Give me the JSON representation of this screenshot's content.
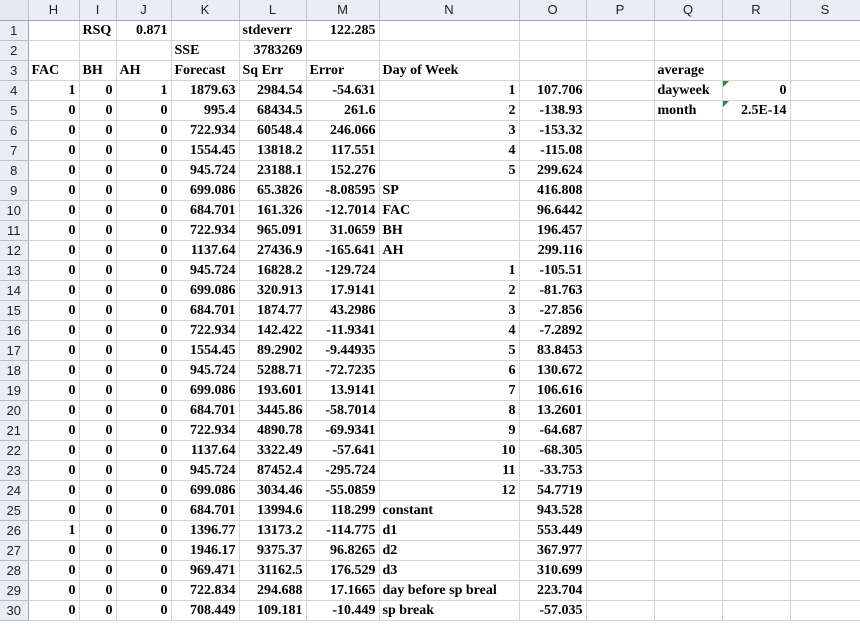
{
  "columns": [
    "H",
    "I",
    "J",
    "K",
    "L",
    "M",
    "N",
    "O",
    "P",
    "Q",
    "R",
    "S"
  ],
  "rows": [
    {
      "n": "1",
      "cells": {
        "I": "RSQ",
        "J": "0.871",
        "L": "stdeverr",
        "M": "122.285"
      }
    },
    {
      "n": "2",
      "cells": {
        "K": "SSE",
        "L": "3783269"
      }
    },
    {
      "n": "3",
      "cells": {
        "H": "FAC",
        "I": "BH",
        "J": "AH",
        "K": "Forecast",
        "L": "Sq Err",
        "M": "Error",
        "N": "Day of Week",
        "Q": "average"
      }
    },
    {
      "n": "4",
      "cells": {
        "H": "1",
        "I": "0",
        "J": "1",
        "K": "1879.63",
        "L": "2984.54",
        "M": "-54.631",
        "N": "1",
        "O": "107.706",
        "Q": "dayweek",
        "R": "0"
      }
    },
    {
      "n": "5",
      "cells": {
        "H": "0",
        "I": "0",
        "J": "0",
        "K": "995.4",
        "L": "68434.5",
        "M": "261.6",
        "N": "2",
        "O": "-138.93",
        "Q": "month",
        "R": "2.5E-14"
      }
    },
    {
      "n": "6",
      "cells": {
        "H": "0",
        "I": "0",
        "J": "0",
        "K": "722.934",
        "L": "60548.4",
        "M": "246.066",
        "N": "3",
        "O": "-153.32"
      }
    },
    {
      "n": "7",
      "cells": {
        "H": "0",
        "I": "0",
        "J": "0",
        "K": "1554.45",
        "L": "13818.2",
        "M": "117.551",
        "N": "4",
        "O": "-115.08"
      }
    },
    {
      "n": "8",
      "cells": {
        "H": "0",
        "I": "0",
        "J": "0",
        "K": "945.724",
        "L": "23188.1",
        "M": "152.276",
        "N": "5",
        "O": "299.624"
      }
    },
    {
      "n": "9",
      "cells": {
        "H": "0",
        "I": "0",
        "J": "0",
        "K": "699.086",
        "L": "65.3826",
        "M": "-8.08595",
        "N": "SP",
        "O": "416.808"
      }
    },
    {
      "n": "10",
      "cells": {
        "H": "0",
        "I": "0",
        "J": "0",
        "K": "684.701",
        "L": "161.326",
        "M": "-12.7014",
        "N": "FAC",
        "O": "96.6442"
      }
    },
    {
      "n": "11",
      "cells": {
        "H": "0",
        "I": "0",
        "J": "0",
        "K": "722.934",
        "L": "965.091",
        "M": "31.0659",
        "N": "BH",
        "O": "196.457"
      }
    },
    {
      "n": "12",
      "cells": {
        "H": "0",
        "I": "0",
        "J": "0",
        "K": "1137.64",
        "L": "27436.9",
        "M": "-165.641",
        "N": "AH",
        "O": "299.116"
      }
    },
    {
      "n": "13",
      "cells": {
        "H": "0",
        "I": "0",
        "J": "0",
        "K": "945.724",
        "L": "16828.2",
        "M": "-129.724",
        "N": "1",
        "O": "-105.51"
      }
    },
    {
      "n": "14",
      "cells": {
        "H": "0",
        "I": "0",
        "J": "0",
        "K": "699.086",
        "L": "320.913",
        "M": "17.9141",
        "N": "2",
        "O": "-81.763"
      }
    },
    {
      "n": "15",
      "cells": {
        "H": "0",
        "I": "0",
        "J": "0",
        "K": "684.701",
        "L": "1874.77",
        "M": "43.2986",
        "N": "3",
        "O": "-27.856"
      }
    },
    {
      "n": "16",
      "cells": {
        "H": "0",
        "I": "0",
        "J": "0",
        "K": "722.934",
        "L": "142.422",
        "M": "-11.9341",
        "N": "4",
        "O": "-7.2892"
      }
    },
    {
      "n": "17",
      "cells": {
        "H": "0",
        "I": "0",
        "J": "0",
        "K": "1554.45",
        "L": "89.2902",
        "M": "-9.44935",
        "N": "5",
        "O": "83.8453"
      }
    },
    {
      "n": "18",
      "cells": {
        "H": "0",
        "I": "0",
        "J": "0",
        "K": "945.724",
        "L": "5288.71",
        "M": "-72.7235",
        "N": "6",
        "O": "130.672"
      }
    },
    {
      "n": "19",
      "cells": {
        "H": "0",
        "I": "0",
        "J": "0",
        "K": "699.086",
        "L": "193.601",
        "M": "13.9141",
        "N": "7",
        "O": "106.616"
      }
    },
    {
      "n": "20",
      "cells": {
        "H": "0",
        "I": "0",
        "J": "0",
        "K": "684.701",
        "L": "3445.86",
        "M": "-58.7014",
        "N": "8",
        "O": "13.2601"
      }
    },
    {
      "n": "21",
      "cells": {
        "H": "0",
        "I": "0",
        "J": "0",
        "K": "722.934",
        "L": "4890.78",
        "M": "-69.9341",
        "N": "9",
        "O": "-64.687"
      }
    },
    {
      "n": "22",
      "cells": {
        "H": "0",
        "I": "0",
        "J": "0",
        "K": "1137.64",
        "L": "3322.49",
        "M": "-57.641",
        "N": "10",
        "O": "-68.305"
      }
    },
    {
      "n": "23",
      "cells": {
        "H": "0",
        "I": "0",
        "J": "0",
        "K": "945.724",
        "L": "87452.4",
        "M": "-295.724",
        "N": "11",
        "O": "-33.753"
      }
    },
    {
      "n": "24",
      "cells": {
        "H": "0",
        "I": "0",
        "J": "0",
        "K": "699.086",
        "L": "3034.46",
        "M": "-55.0859",
        "N": "12",
        "O": "54.7719"
      }
    },
    {
      "n": "25",
      "cells": {
        "H": "0",
        "I": "0",
        "J": "0",
        "K": "684.701",
        "L": "13994.6",
        "M": "118.299",
        "N": "constant",
        "O": "943.528"
      }
    },
    {
      "n": "26",
      "cells": {
        "H": "1",
        "I": "0",
        "J": "0",
        "K": "1396.77",
        "L": "13173.2",
        "M": "-114.775",
        "N": "d1",
        "O": "553.449"
      }
    },
    {
      "n": "27",
      "cells": {
        "H": "0",
        "I": "0",
        "J": "0",
        "K": "1946.17",
        "L": "9375.37",
        "M": "96.8265",
        "N": "d2",
        "O": "367.977"
      }
    },
    {
      "n": "28",
      "cells": {
        "H": "0",
        "I": "0",
        "J": "0",
        "K": "969.471",
        "L": "31162.5",
        "M": "176.529",
        "N": "d3",
        "O": "310.699"
      }
    },
    {
      "n": "29",
      "cells": {
        "H": "0",
        "I": "0",
        "J": "0",
        "K": "722.834",
        "L": "294.688",
        "M": "17.1665",
        "N": "day before sp breal",
        "O": "223.704"
      }
    },
    {
      "n": "30",
      "cells": {
        "H": "0",
        "I": "0",
        "J": "0",
        "K": "708.449",
        "L": "109.181",
        "M": "-10.449",
        "N": "sp break",
        "O": "-57.035"
      }
    }
  ],
  "text_cells": [
    "I1",
    "L1",
    "K2",
    "H3",
    "I3",
    "J3",
    "K3",
    "L3",
    "M3",
    "N3",
    "Q3",
    "Q4",
    "Q5",
    "N9",
    "N10",
    "N11",
    "N12",
    "N25",
    "N26",
    "N27",
    "N28",
    "N29",
    "N30"
  ],
  "red_cells": [
    "M5",
    "M6",
    "M23"
  ],
  "flag_cells": [
    "R4",
    "R5"
  ],
  "colors": {
    "red_text": "#e02020",
    "flag_green": "#1f8f3a",
    "header_bg": "#e9eef5",
    "grid_line": "#d4d4d4"
  }
}
